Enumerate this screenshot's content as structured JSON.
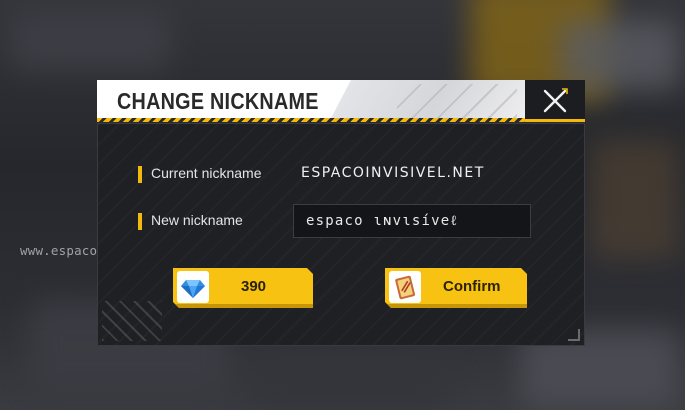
{
  "watermark": "www.espacoinvisivel.net",
  "dialog": {
    "title": "CHANGE NICKNAME",
    "current_label": "Current nickname",
    "current_value": "ESPACOINVISIVEL.NET",
    "new_label": "New nickname",
    "new_value": "espaco ɩɴvɩsíveℓ",
    "price": "390",
    "confirm_label": "Confirm"
  },
  "icons": {
    "close": "close-icon",
    "price": "diamond-icon",
    "confirm": "name-change-card-icon"
  },
  "colors": {
    "accent": "#f7c211",
    "panel": "#1f2024",
    "header": "#ffffff"
  }
}
